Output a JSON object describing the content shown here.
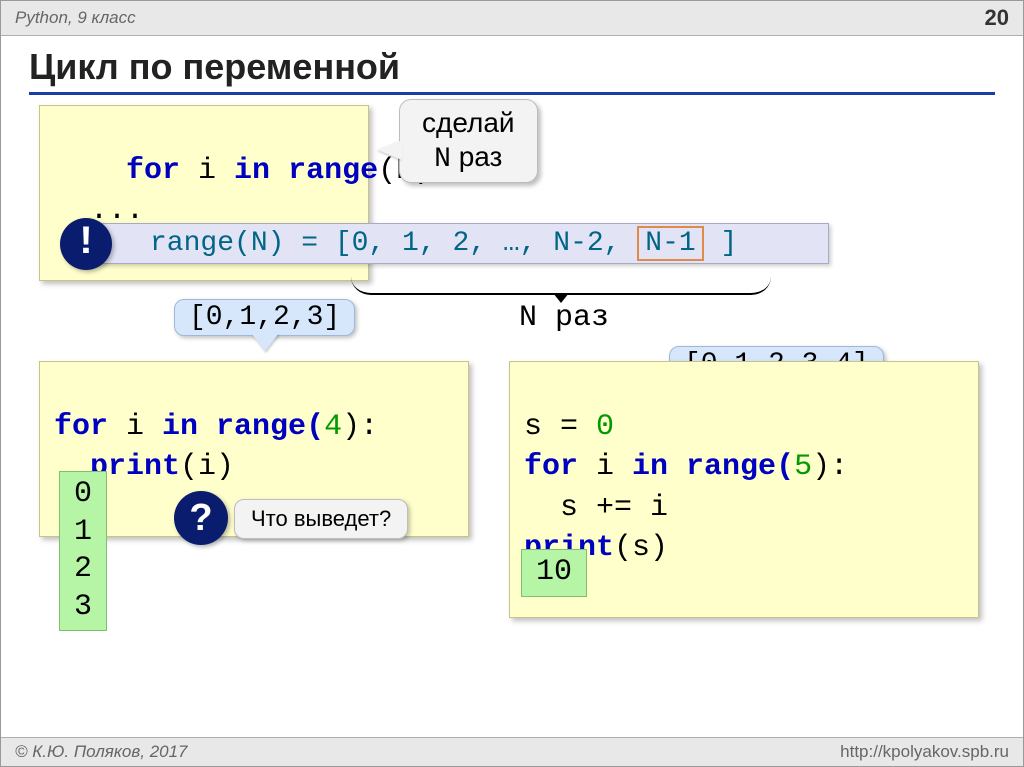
{
  "topbar": {
    "left": "Python, 9 класс",
    "page": "20"
  },
  "title": "Цикл по переменной",
  "block1": {
    "kw1": "for",
    "var": " i ",
    "kw2": "in",
    "fn": " range",
    "arg": "(N):",
    "body": "  ..."
  },
  "bubble1": {
    "line1": "сделай",
    "line2_pre": "N",
    "line2_post": " раз"
  },
  "strip": {
    "pre": "range(N) = [0, 1, 2, …, N-2, ",
    "boxed": "N-1",
    "post": " ]",
    "mark": "!"
  },
  "brace_label": "N раз",
  "labelA": "[0,1,2,3]",
  "labelB": "[0,1,2,3,4]",
  "block2": {
    "l1_kw1": "for",
    "l1_mid": " i ",
    "l1_kw2": "in",
    "l1_fn": " range(",
    "l1_num": "4",
    "l1_end": "):",
    "l2_fn": "  print",
    "l2_arg": "(i)"
  },
  "block3": {
    "l1": "s = ",
    "l1_num": "0",
    "l2_kw1": "for",
    "l2_mid": " i ",
    "l2_kw2": "in",
    "l2_fn": " range(",
    "l2_num": "5",
    "l2_end": "):",
    "l3": "  s += i",
    "l4_fn": "print",
    "l4_arg": "(s)"
  },
  "outputA": "0\n1\n2\n3",
  "outputB": "10",
  "question": {
    "mark": "?",
    "text": "Что выведет?"
  },
  "footer": {
    "left": "© К.Ю. Поляков, 2017",
    "right": "http://kpolyakov.spb.ru"
  }
}
